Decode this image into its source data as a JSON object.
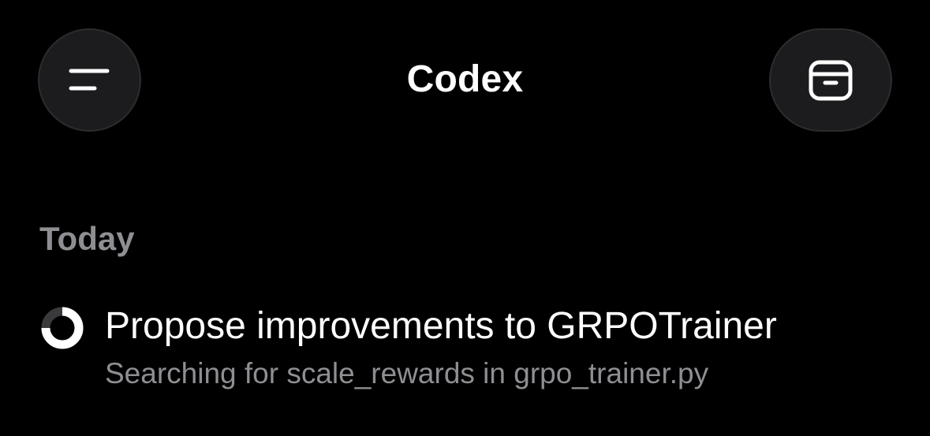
{
  "header": {
    "title": "Codex",
    "menu_icon": "menu-icon",
    "archive_icon": "archive-icon"
  },
  "sections": [
    {
      "label": "Today",
      "tasks": [
        {
          "title": "Propose improvements to GRPOTrainer",
          "status": "Searching for scale_rewards in grpo_trainer.py",
          "state_icon": "progress-spinner-icon"
        }
      ]
    }
  ],
  "colors": {
    "background": "#000000",
    "button_background": "#1c1c1e",
    "secondary_text": "#8e8e93",
    "primary_text": "#ffffff"
  }
}
